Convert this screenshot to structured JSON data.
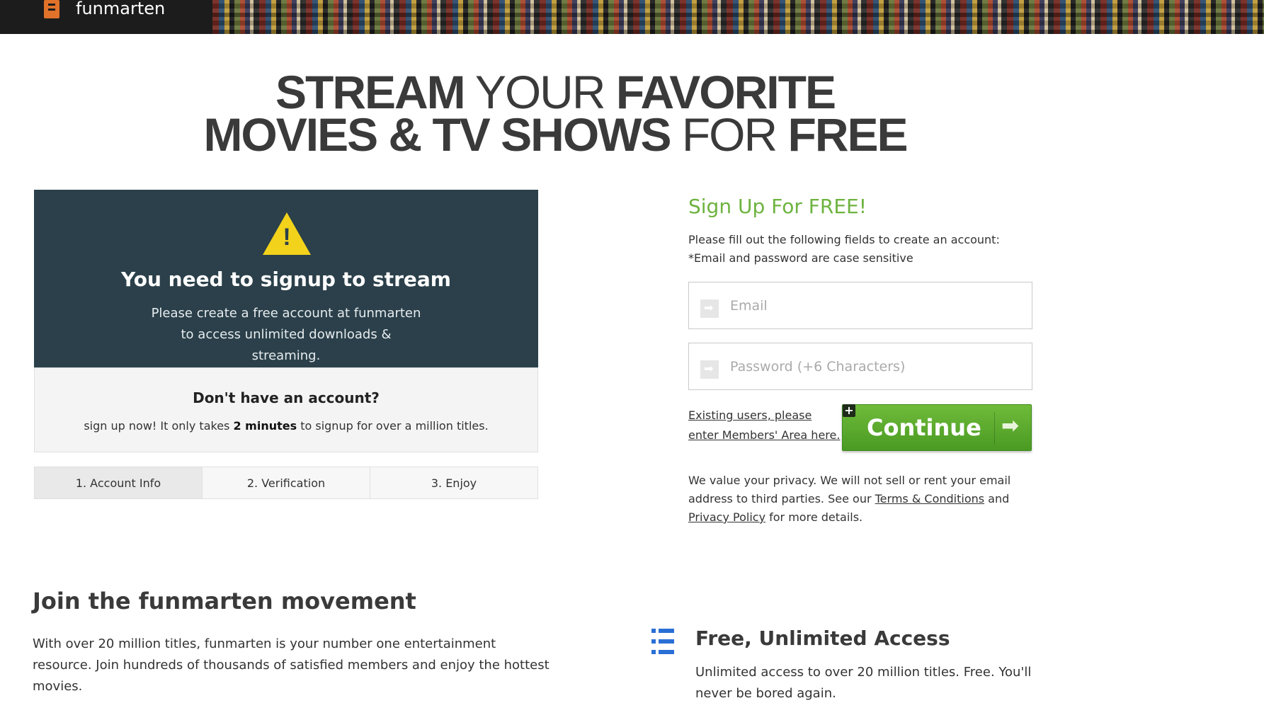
{
  "header": {
    "brand": "funmarten",
    "logo_icon": "film-strip-icon"
  },
  "hero": {
    "line1_bold_a": "STREAM",
    "line1_light": " YOUR ",
    "line1_bold_b": "FAVORITE",
    "line2_bold": "MOVIES & TV SHOWS",
    "line2_light": " FOR ",
    "line2_bold_b": "FREE"
  },
  "notice": {
    "icon": "warning-icon",
    "warning_mark": "!",
    "title": "You need to signup to stream",
    "text": "Please create a free account at funmarten to access unlimited downloads & streaming."
  },
  "no_account": {
    "title": "Don't have an account?",
    "text_before": "sign up now! It only takes ",
    "text_bold": "2 minutes",
    "text_after": " to signup for over a million titles."
  },
  "steps": [
    {
      "label": "1. Account Info",
      "active": true
    },
    {
      "label": "2. Verification",
      "active": false
    },
    {
      "label": "3. Enjoy",
      "active": false
    }
  ],
  "signup": {
    "title": "Sign Up For FREE!",
    "desc_line1": "Please fill out the following fields to create an account:",
    "desc_line2": "*Email and password are case sensitive",
    "email_placeholder": "Email",
    "password_placeholder": "Password (+6 Characters)",
    "existing_link": "Existing users, please enter Members' Area here.",
    "continue_label": "Continue",
    "plus_badge": "+",
    "continue_arrow": "➡",
    "privacy_before": "We value your privacy. We will not sell or rent your email address to third parties. See our ",
    "terms_link": "Terms & Conditions",
    "privacy_and": " and ",
    "privacy_link": "Privacy Policy",
    "privacy_after": " for more details."
  },
  "movement": {
    "title": "Join the funmarten movement",
    "text": "With over 20 million titles, funmarten is your number one entertainment resource. Join hundreds of thousands of satisfied members and enjoy the hottest movies."
  },
  "feature": {
    "icon": "list-icon",
    "title": "Free, Unlimited Access",
    "text": "Unlimited access to over 20 million titles. Free. You'll never be bored again."
  },
  "colors": {
    "accent_green": "#6db33f",
    "card_dark": "#2b404a",
    "warning_yellow": "#f2d21b",
    "icon_blue": "#2a6fd6"
  }
}
